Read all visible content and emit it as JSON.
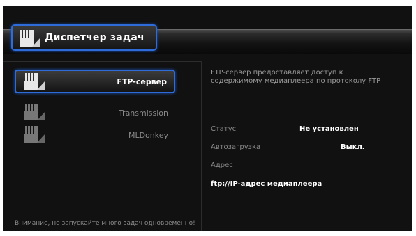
{
  "header": {
    "title": "Диспетчер задач",
    "icon": "task-manager-icon"
  },
  "tasks": [
    {
      "label": "FTP-сервер",
      "selected": true,
      "icon": "task-icon"
    },
    {
      "label": "Transmission",
      "selected": false,
      "icon": "task-icon"
    },
    {
      "label": "MLDonkey",
      "selected": false,
      "icon": "task-icon"
    }
  ],
  "details": {
    "description": "FTP-сервер предоставляет доступ к содержимому медиаплеера по протоколу FTP",
    "status_label": "Статус",
    "status_value": "Не установлен",
    "autostart_label": "Автозагрузка",
    "autostart_value": "Выкл.",
    "address_label": "Адрес",
    "address_value": "ftp://IP-адрес медиаплеера"
  },
  "footer": {
    "warning": "Внимание, не запускайте много задач одновременно!"
  },
  "colors": {
    "accent": "#2d6cd9",
    "background": "#111111"
  }
}
